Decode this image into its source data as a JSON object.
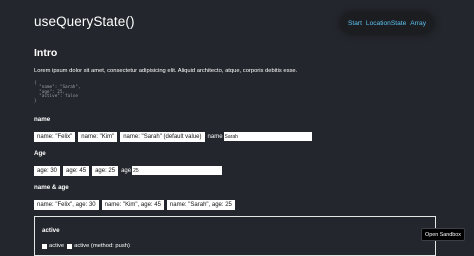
{
  "app": {
    "title": "useQueryState()"
  },
  "nav": {
    "links": [
      "Start",
      "LocationState",
      "Array"
    ]
  },
  "intro": {
    "heading": "Intro",
    "text": "Lorem ipsum dolor sit amet, consectetur adipisicing elit. Aliquid architecto, atque, corporis debitis esse.",
    "state_lines": [
      "{",
      "  \"name\": \"Sarah\",",
      "  \"age\": 25,",
      "  \"active\": false",
      "}"
    ]
  },
  "name_section": {
    "label": "name",
    "buttons": [
      "name: \"Felix\"",
      "name: \"Kim\"",
      "name: \"Sarah\" (default value)"
    ],
    "input_label": "name",
    "input_value": "Sarah"
  },
  "age_section": {
    "label": "Age",
    "buttons": [
      "age: 30",
      "age: 45",
      "age: 25"
    ],
    "input_label": "age",
    "input_value": "25"
  },
  "name_age_section": {
    "label": "name & age",
    "buttons": [
      "name: \"Felix\", age: 30",
      "name: \"Kim\", age: 45",
      "name: \"Sarah\", age: 25"
    ]
  },
  "active_section": {
    "label": "active",
    "checkbox1_label": "active",
    "checkbox2_label": "active (method: push)"
  },
  "sandbox": {
    "label": "Open Sandbox"
  }
}
